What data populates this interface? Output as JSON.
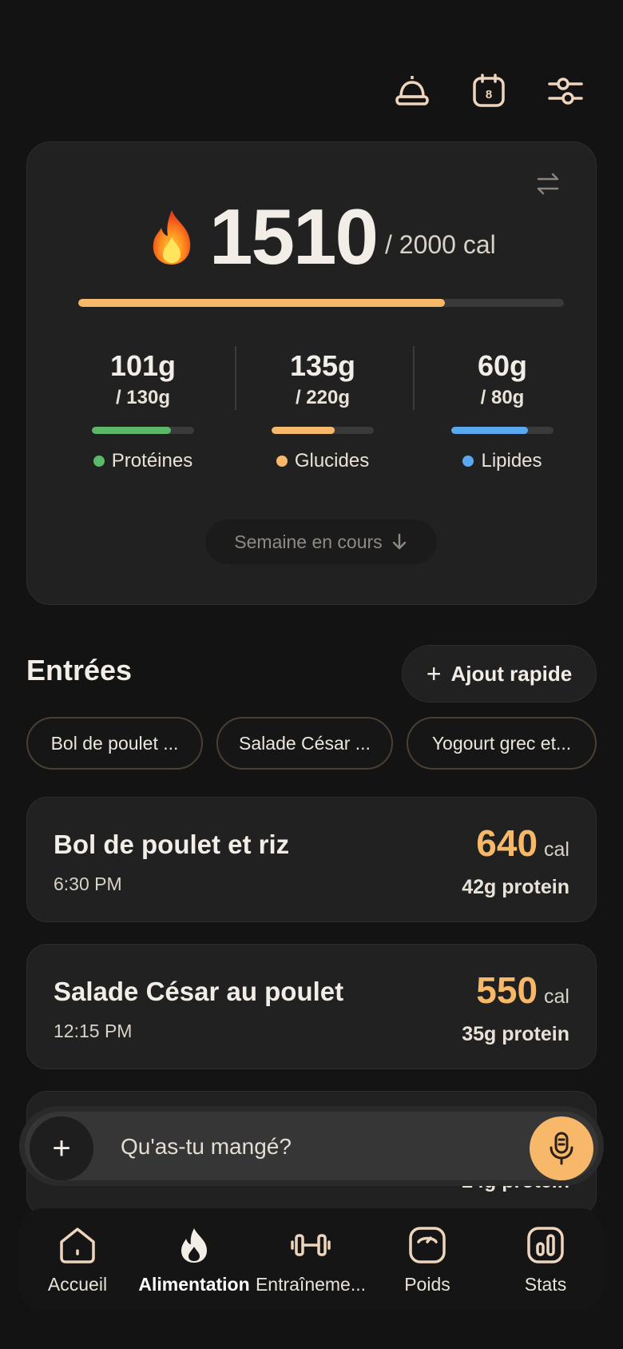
{
  "header": {
    "icons": [
      "bell-icon",
      "calendar-icon",
      "filters-icon"
    ],
    "calendar_day": "8"
  },
  "summary": {
    "calories": "1510",
    "goal": "/ 2000 cal",
    "progress": 0.755,
    "progress_color": "#f7b86a",
    "macros": [
      {
        "value": "101g",
        "goal": "/ 130g",
        "label": "Protéines",
        "progress": 0.777,
        "color": "#5bb76a"
      },
      {
        "value": "135g",
        "goal": "/ 220g",
        "label": "Glucides",
        "progress": 0.614,
        "color": "#f7b86a"
      },
      {
        "value": "60g",
        "goal": "/ 80g",
        "label": "Lipides",
        "progress": 0.75,
        "color": "#5aa9ee"
      }
    ],
    "week_button": "Semaine en cours"
  },
  "entries_section": {
    "title": "Entrées",
    "quick_add": "Ajout rapide",
    "chips": [
      "Bol de poulet ...",
      "Salade César ...",
      "Yogourt grec et..."
    ],
    "items": [
      {
        "name": "Bol de poulet et riz",
        "time": "6:30 PM",
        "cal": "640",
        "unit": "cal",
        "protein": "42g protein"
      },
      {
        "name": "Salade César au poulet",
        "time": "12:15 PM",
        "cal": "550",
        "unit": "cal",
        "protein": "35g protein"
      },
      {
        "protein": "24g protein"
      }
    ]
  },
  "input": {
    "placeholder": "Qu'as-tu mangé?"
  },
  "tabs": [
    {
      "label": "Accueil",
      "icon": "home-icon"
    },
    {
      "label": "Alimentation",
      "icon": "flame-icon",
      "active": true
    },
    {
      "label": "Entraîneme...",
      "icon": "dumbbell-icon"
    },
    {
      "label": "Poids",
      "icon": "scale-icon"
    },
    {
      "label": "Stats",
      "icon": "stats-icon"
    }
  ]
}
